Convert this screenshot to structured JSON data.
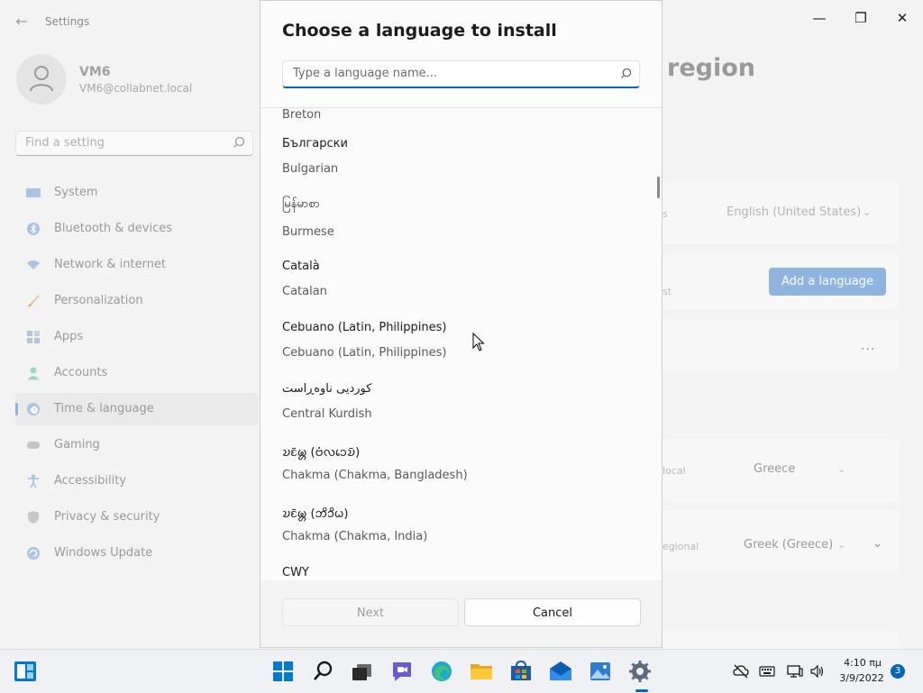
{
  "settings": {
    "app_title": "Settings",
    "user": {
      "name": "VM6",
      "email": "VM6@collabnet.local"
    },
    "search_placeholder": "Find a setting",
    "nav": [
      {
        "label": "System",
        "icon": "monitor-icon",
        "selected": false
      },
      {
        "label": "Bluetooth & devices",
        "icon": "bluetooth-icon",
        "selected": false
      },
      {
        "label": "Network & internet",
        "icon": "wifi-icon",
        "selected": false
      },
      {
        "label": "Personalization",
        "icon": "brush-icon",
        "selected": false
      },
      {
        "label": "Apps",
        "icon": "apps-icon",
        "selected": false
      },
      {
        "label": "Accounts",
        "icon": "person-icon",
        "selected": false
      },
      {
        "label": "Time & language",
        "icon": "globe-clock-icon",
        "selected": true
      },
      {
        "label": "Gaming",
        "icon": "gamepad-icon",
        "selected": false
      },
      {
        "label": "Accessibility",
        "icon": "accessibility-icon",
        "selected": false
      },
      {
        "label": "Privacy & security",
        "icon": "shield-icon",
        "selected": false
      },
      {
        "label": "Windows Update",
        "icon": "update-icon",
        "selected": false
      }
    ],
    "page_title_fragment": "region",
    "display_language_frag": "s",
    "display_language_value": "English (United States)",
    "preferred_frag": "st",
    "add_language_label": "Add a language",
    "more_label": "...",
    "country_frag": "local",
    "country_value": "Greece",
    "regional_frag": "egional",
    "regional_value": "Greek (Greece)"
  },
  "dialog": {
    "title": "Choose a language to install",
    "search_placeholder": "Type a language name...",
    "partial_top": "Breton",
    "items": [
      {
        "native": "Български",
        "english": "Bulgarian"
      },
      {
        "native": "မြန်မာစာ",
        "english": "Burmese"
      },
      {
        "native": "Català",
        "english": "Catalan"
      },
      {
        "native": "Cebuano (Latin, Philippines)",
        "english": "Cebuano (Latin, Philippines)"
      },
      {
        "native": "کوردیی ناوەڕاست",
        "english": "Central Kurdish"
      },
      {
        "native": "𑄌𑄋𑄴𑄟𑄳𑄦 (𑄝𑄁𑄣𑄘𑄬𑄌𑄴)",
        "english": "Chakma (Chakma, Bangladesh)"
      },
      {
        "native": "𑄌𑄋𑄴𑄟𑄳𑄦 (𑄃𑄨𑄘𑄨𑄠)",
        "english": "Chakma (Chakma, India)"
      }
    ],
    "partial_bottom": "CWY",
    "next_label": "Next",
    "cancel_label": "Cancel"
  },
  "taskbar": {
    "time": "4:10 πμ",
    "date": "3/9/2022",
    "notification_count": "3"
  }
}
